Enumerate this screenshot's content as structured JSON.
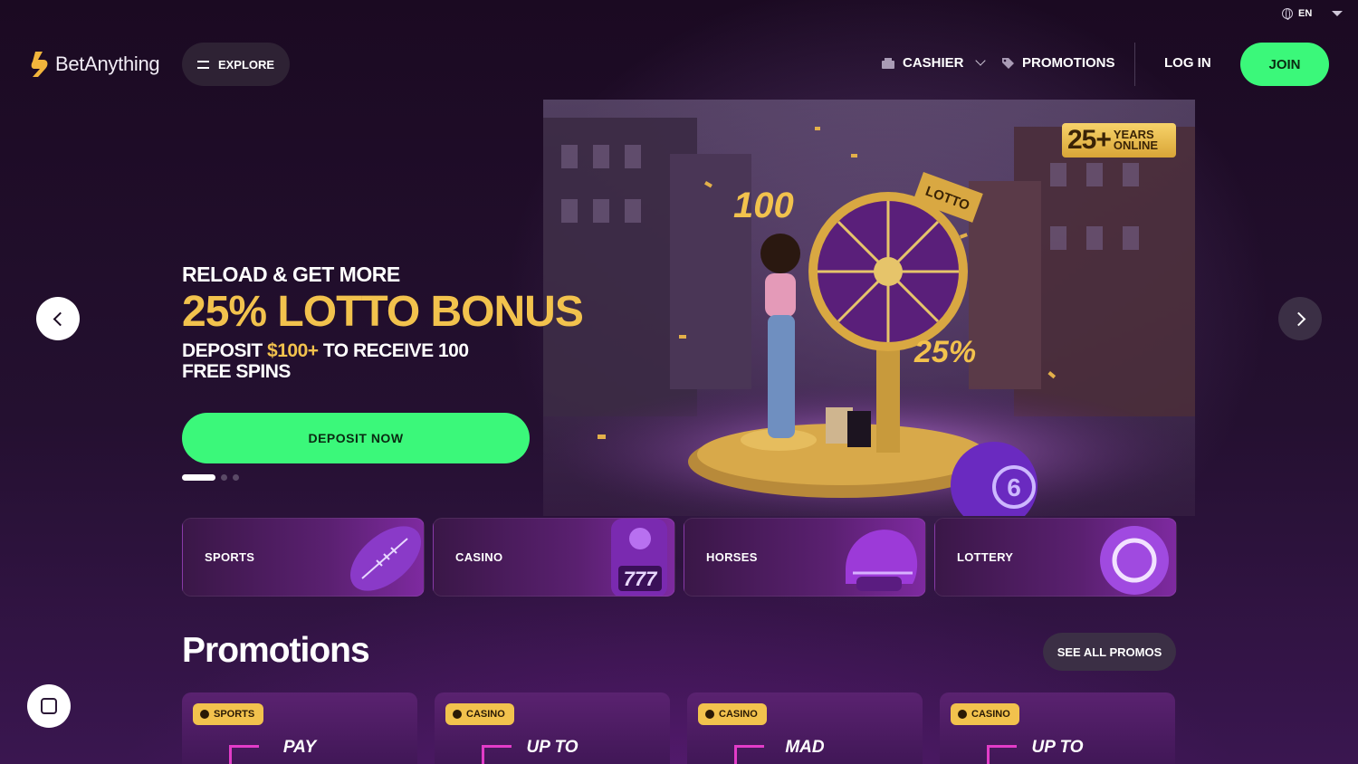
{
  "header": {
    "language": "EN",
    "brand": "BetAnything",
    "explore_label": "EXPLORE",
    "cashier_label": "CASHIER",
    "promotions_label": "PROMOTIONS",
    "login_label": "LOG IN",
    "join_label": "JOIN"
  },
  "hero": {
    "eyebrow": "RELOAD & GET MORE",
    "headline": "25% LOTTO  BONUS",
    "sub_prefix": "DEPOSIT ",
    "sub_highlight": "$100+",
    "sub_suffix": " TO RECEIVE 100 FREE SPINS",
    "cta_label": "DEPOSIT NOW",
    "years_number": "25+",
    "years_line1": "YEARS",
    "years_line2": "ONLINE",
    "slide_count": 3,
    "active_slide": 1
  },
  "categories": [
    {
      "label": "SPORTS",
      "icon": "football-icon"
    },
    {
      "label": "CASINO",
      "icon": "slot-machine-icon"
    },
    {
      "label": "HORSES",
      "icon": "jockey-helmet-icon"
    },
    {
      "label": "LOTTERY",
      "icon": "lottery-ball-icon"
    }
  ],
  "promotions": {
    "title": "Promotions",
    "see_all_label": "SEE ALL PROMOS",
    "cards": [
      {
        "chip": "SPORTS",
        "title": "PAY"
      },
      {
        "chip": "CASINO",
        "title": "UP TO"
      },
      {
        "chip": "CASINO",
        "title": "MAD"
      },
      {
        "chip": "CASINO",
        "title": "UP TO"
      }
    ]
  },
  "colors": {
    "accent_green": "#3bf87a",
    "gold": "#f2c24d",
    "background": "#1c0a24"
  }
}
